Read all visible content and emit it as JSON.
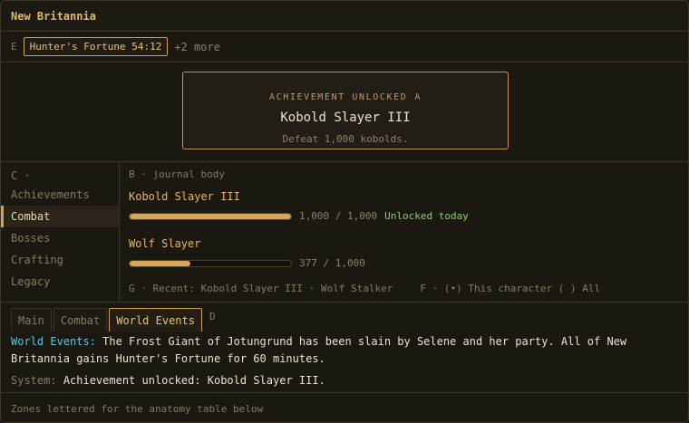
{
  "window": {
    "title": "New Britannia"
  },
  "buffs": {
    "zone": "E",
    "chip": "Hunter's Fortune 54:12",
    "more": "+2 more"
  },
  "banner": {
    "heading": "ACHIEVEMENT UNLOCKED",
    "zone": "A",
    "name": "Kobold Slayer III",
    "description": "Defeat 1,000 kobolds."
  },
  "sidebar": {
    "zone": "C ·",
    "items": [
      {
        "label": "Achievements"
      },
      {
        "label": "Combat"
      },
      {
        "label": "Bosses"
      },
      {
        "label": "Crafting"
      },
      {
        "label": "Legacy"
      }
    ]
  },
  "journal": {
    "zone": "B · journal body",
    "achievements": [
      {
        "name": "Kobold Slayer III",
        "count": "1,000 / 1,000",
        "progress": 1.0,
        "tag": "Unlocked today"
      },
      {
        "name": "Wolf Slayer",
        "count": "377 / 1,000",
        "progress": 0.377,
        "tag": ""
      }
    ],
    "recent": "G · Recent: Kobold Slayer III · Wolf Stalker",
    "filter": "F · (•) This character ( ) All"
  },
  "chat": {
    "tabs": [
      {
        "label": "Main"
      },
      {
        "label": "Combat"
      },
      {
        "label": "World Events"
      }
    ],
    "zone": "D",
    "messages": [
      {
        "channel": "World Events:",
        "text": "The Frost Giant of Jotungrund has been slain by Selene and her party. All of New Britannia gains Hunter's Fortune for 60 minutes."
      },
      {
        "channel": "System:",
        "text": "Achievement unlocked: Kobold Slayer III."
      }
    ]
  },
  "footer": {
    "text": "Zones lettered for the anatomy table below"
  },
  "colors": {
    "accent": "#d0a358",
    "world_channel": "#5fc5d9",
    "unlocked": "#8fcc6e"
  }
}
